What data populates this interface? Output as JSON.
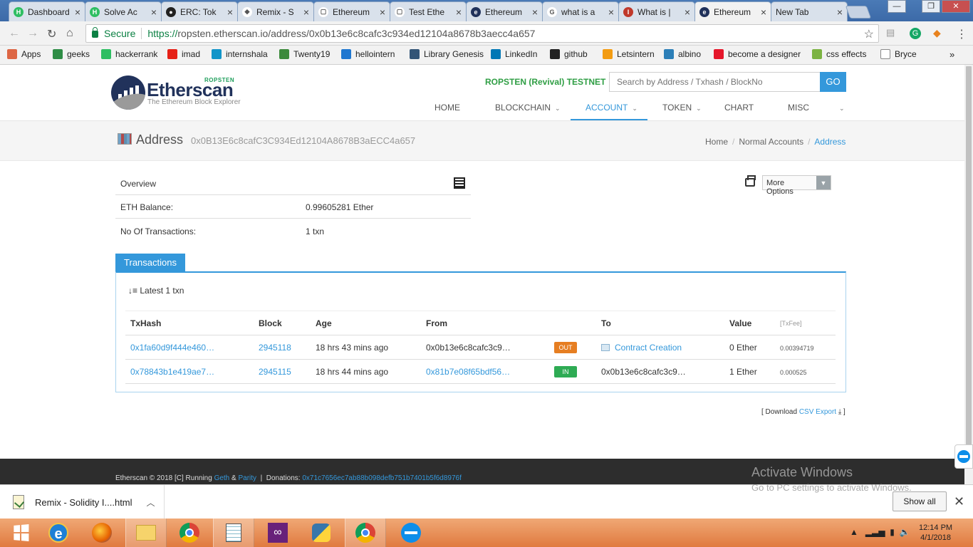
{
  "browser": {
    "tabs": [
      {
        "title": "Dashboard",
        "fav_color": "#2ebe62",
        "fav_char": "H"
      },
      {
        "title": "Solve Ac",
        "fav_color": "#2ebe62",
        "fav_char": "H"
      },
      {
        "title": "ERC: Tok",
        "fav_color": "#222222",
        "fav_char": "●"
      },
      {
        "title": "Remix - S",
        "fav_color": "#ffffff",
        "fav_char": "◆"
      },
      {
        "title": "Ethereum",
        "fav_color": "#ffffff",
        "fav_char": "▢"
      },
      {
        "title": "Test Ethe",
        "fav_color": "#ffffff",
        "fav_char": "▢"
      },
      {
        "title": "Ethereum",
        "fav_color": "#21325b",
        "fav_char": "e"
      },
      {
        "title": "what is a",
        "fav_color": "#ffffff",
        "fav_char": "G"
      },
      {
        "title": "What is |",
        "fav_color": "#c0392b",
        "fav_char": "I"
      },
      {
        "title": "Ethereum",
        "fav_color": "#21325b",
        "fav_char": "e"
      },
      {
        "title": "New Tab",
        "fav_color": "",
        "fav_char": ""
      }
    ],
    "active_tab": 9,
    "secure_label": "Secure",
    "url_scheme": "https://",
    "url_rest": "ropsten.etherscan.io/address/0x0b13e6c8cafc3c934ed12104a8678b3aecc4a657"
  },
  "bookmarks": [
    {
      "label": "Apps",
      "icon_color": "#d64",
      "icon": "apps-icon"
    },
    {
      "label": "geeks",
      "icon_color": "#2f8d46",
      "icon": "geeks-icon"
    },
    {
      "label": "hackerrank",
      "icon_color": "#2ebe62",
      "icon": "hackerrank-icon"
    },
    {
      "label": "imad",
      "icon_color": "#e62117",
      "icon": "youtube-icon"
    },
    {
      "label": "internshala",
      "icon_color": "#1295c9",
      "icon": "internshala-icon"
    },
    {
      "label": "Twenty19",
      "icon_color": "#3b8a3b",
      "icon": "twenty19-icon"
    },
    {
      "label": "hellointern",
      "icon_color": "#1f77d0",
      "icon": "hellointern-icon"
    },
    {
      "label": "Library Genesis",
      "icon_color": "#335577",
      "icon": "libgen-icon"
    },
    {
      "label": "LinkedIn",
      "icon_color": "#0077b5",
      "icon": "linkedin-icon"
    },
    {
      "label": "github",
      "icon_color": "#222222",
      "icon": "github-icon"
    },
    {
      "label": "Letsintern",
      "icon_color": "#f39c12",
      "icon": "letsintern-icon"
    },
    {
      "label": "albino",
      "icon_color": "#2c7fb8",
      "icon": "albino-icon"
    },
    {
      "label": "become a designer",
      "icon_color": "#e5162a",
      "icon": "designer-icon"
    },
    {
      "label": "css effects",
      "icon_color": "#7cb342",
      "icon": "css-effects-icon"
    },
    {
      "label": "Bryce",
      "icon_color": "#ffffff",
      "icon": "page-icon"
    }
  ],
  "site": {
    "logo_text": "Etherscan",
    "logo_badge": "ROPSTEN",
    "logo_sub": "The Ethereum Block Explorer",
    "network": "ROPSTEN (Revival) TESTNET",
    "search_placeholder": "Search by Address / Txhash / BlockNo",
    "go_label": "GO",
    "menu": [
      "HOME",
      "BLOCKCHAIN",
      "ACCOUNT",
      "TOKEN",
      "CHART",
      "MISC"
    ],
    "active_menu": "ACCOUNT"
  },
  "address": {
    "title": "Address",
    "hash": "0x0B13E6c8cafC3C934Ed12104A8678B3aECC4a657",
    "breadcrumb": [
      "Home",
      "Normal Accounts",
      "Address"
    ]
  },
  "overview": {
    "title": "Overview",
    "balance_label": "ETH Balance:",
    "balance_value": "0.99605281 Ether",
    "txcount_label": "No Of Transactions:",
    "txcount_value": "1 txn",
    "more_options": "More Options"
  },
  "transactions": {
    "tab_label": "Transactions",
    "latest": "Latest 1 txn",
    "headers": [
      "TxHash",
      "Block",
      "Age",
      "From",
      "",
      "To",
      "Value",
      "[TxFee]"
    ],
    "rows": [
      {
        "txhash": "0x1fa60d9f444e460…",
        "block": "2945118",
        "age": "18 hrs 43 mins ago",
        "from": "0x0b13e6c8cafc3c9…",
        "from_link": false,
        "dir": "OUT",
        "to": "Contract Creation",
        "to_link": true,
        "value": "0 Ether",
        "fee": "0.00394719"
      },
      {
        "txhash": "0x78843b1e419ae7…",
        "block": "2945115",
        "age": "18 hrs 44 mins ago",
        "from": "0x81b7e08f65bdf56…",
        "from_link": true,
        "dir": "IN",
        "to": "0x0b13e6c8cafc3c9…",
        "to_link": false,
        "value": "1 Ether",
        "fee": "0.000525"
      }
    ],
    "csv_prefix": "[ Download ",
    "csv_link": "CSV Export",
    "csv_suffix": " ]"
  },
  "footer": {
    "text": "Etherscan © 2018 [C] Running ",
    "geth": "Geth",
    "and": " & ",
    "parity": "Parity",
    "donations_label": "  |  Donations: ",
    "donation_addr": "0x71c7656ec7ab88b098defb751b7401b5f6d8976f"
  },
  "watermark": {
    "line1": "Activate Windows",
    "line2": "Go to PC settings to activate Windows."
  },
  "downloads": {
    "file": "Remix - Solidity I....html",
    "show_all": "Show all"
  },
  "taskbar": {
    "time": "12:14 PM",
    "date": "4/1/2018"
  }
}
